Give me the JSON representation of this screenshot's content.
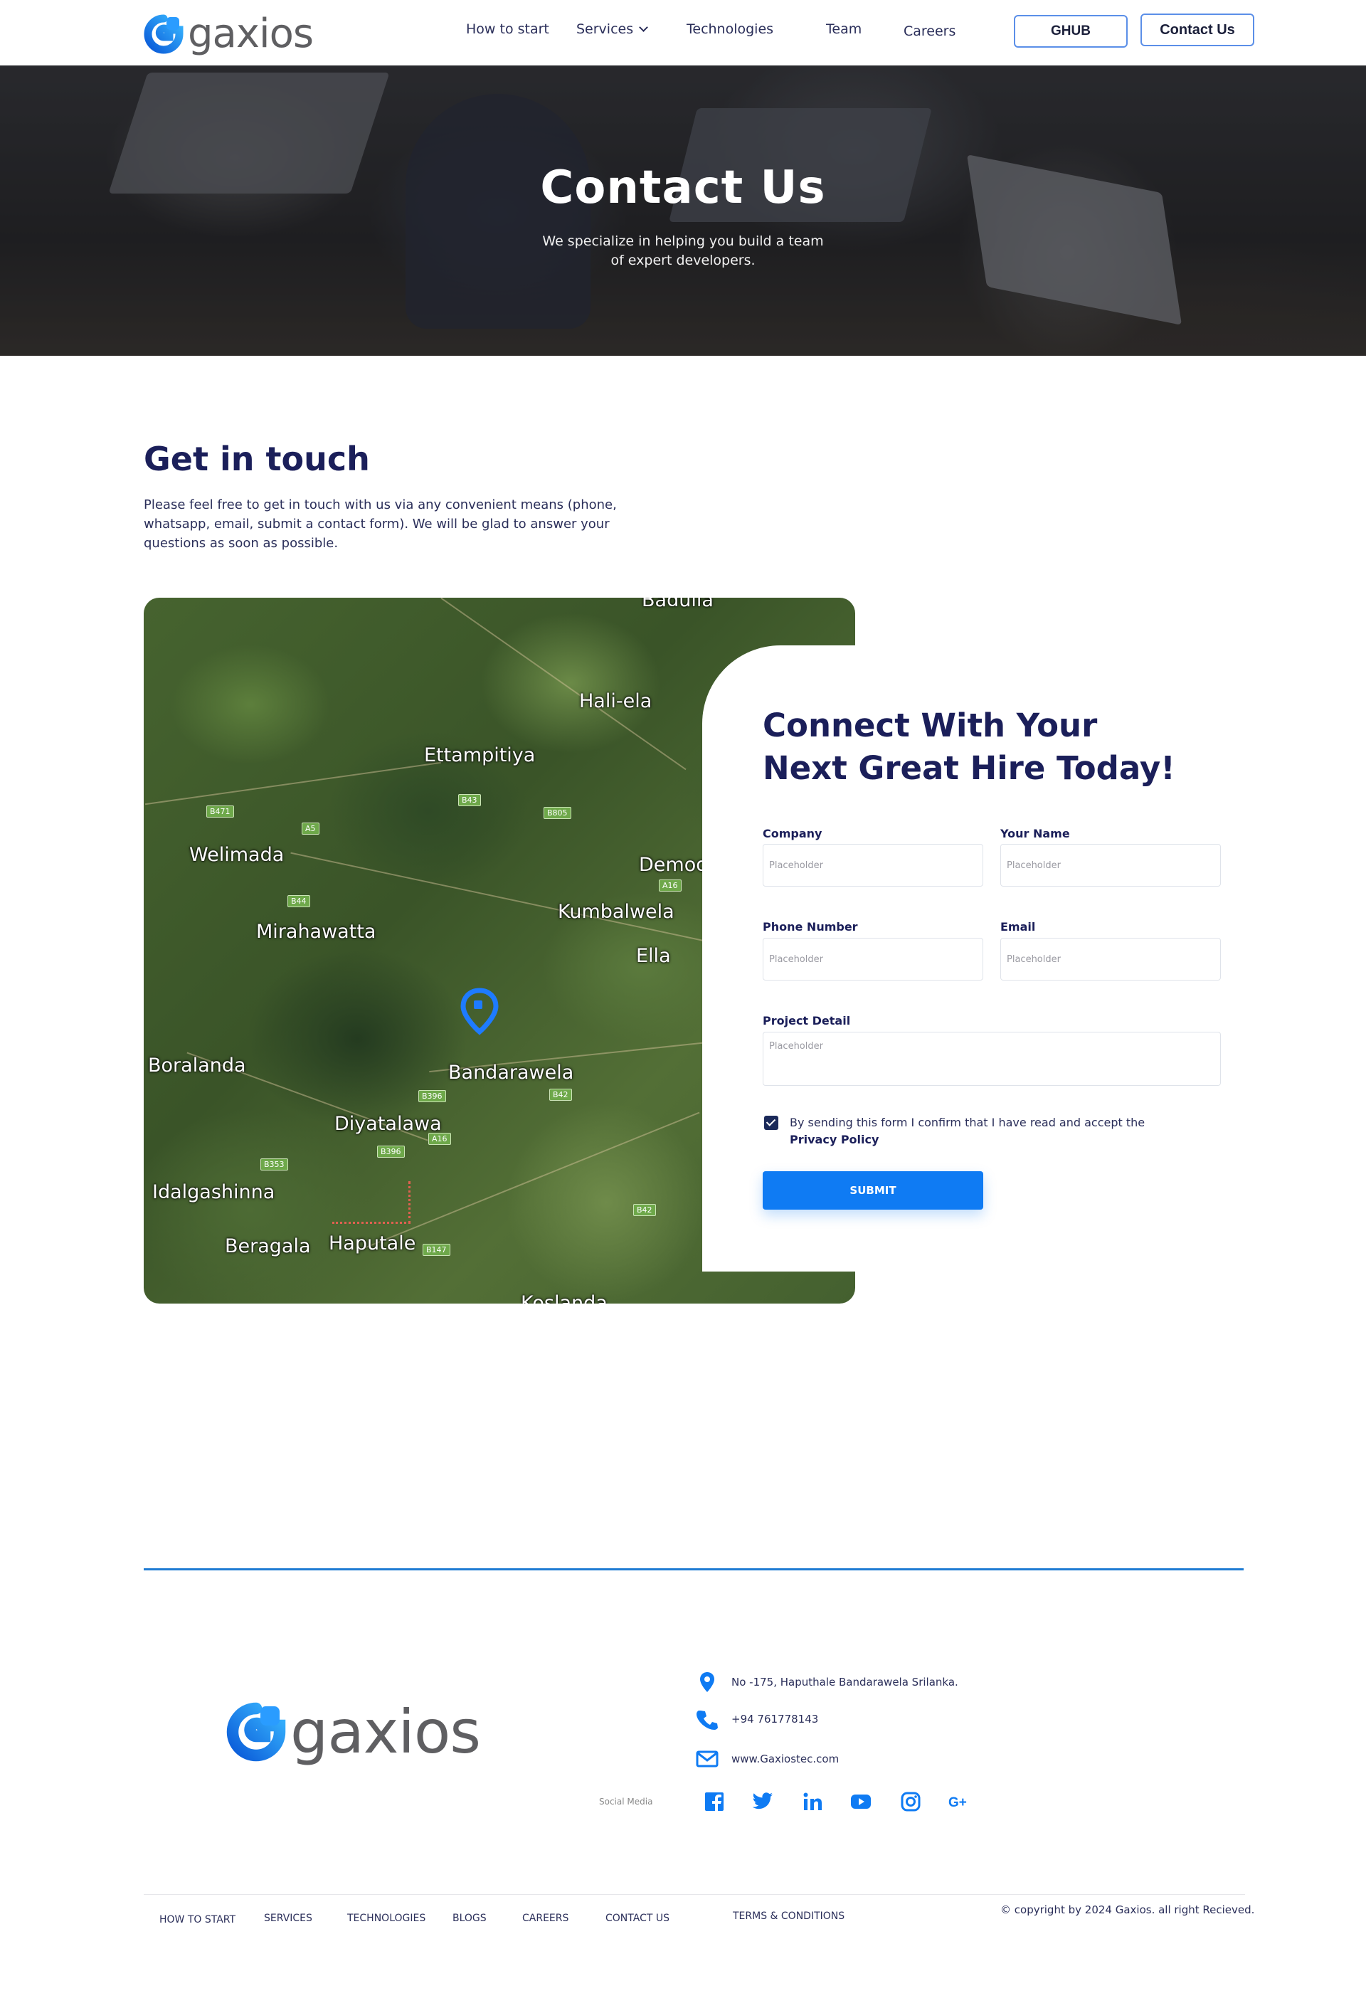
{
  "brand": {
    "name": "gaxios",
    "accent": "#0f7bf3",
    "navy": "#1b1f5a"
  },
  "nav": {
    "items": [
      {
        "label": "How to start"
      },
      {
        "label": "Services"
      },
      {
        "label": "Technologies"
      },
      {
        "label": "Team"
      },
      {
        "label": "Careers"
      }
    ],
    "ghub_label": "GHUB",
    "contact_label": "Contact Us"
  },
  "hero": {
    "title": "Contact Us",
    "subtitle": "We specialize in helping you build a team of expert developers."
  },
  "touch": {
    "title": "Get in touch",
    "text": "Please feel free to get in touch with us via any convenient means (phone, whatsapp, email, submit a contact form). We will be glad to answer your questions as soon as possible."
  },
  "map": {
    "places": [
      "Badulla",
      "Hali-ela",
      "Ettampitiya",
      "Welimada",
      "Demod",
      "Kumbalwela",
      "Mirahawatta",
      "Ella",
      "Boralanda",
      "Bandarawela",
      "Diyatalawa",
      "Idalgashinna",
      "Beragala",
      "Haputale",
      "Koslanda"
    ],
    "road_shields": [
      "B471",
      "A5",
      "B43",
      "B805",
      "B44",
      "A16",
      "B396",
      "B42",
      "A16",
      "B396",
      "B353",
      "B42",
      "B147"
    ]
  },
  "form": {
    "title_line1": "Connect With Your",
    "title_line2": "Next Great Hire Today!",
    "company_label": "Company",
    "name_label": "Your Name",
    "phone_label": "Phone Number",
    "email_label": "Email",
    "project_label": "Project Detail",
    "placeholder": "Placeholder",
    "consent_text": "By sending this form I confirm that I have read and accept the",
    "privacy_label": "Privacy Policy",
    "submit_label": "SUBMIT"
  },
  "footer": {
    "address": "No -175, Haputhale Bandarawela Srilanka.",
    "phone": "+94 761778143",
    "website": "www.Gaxiostec.com",
    "social_label": "Social Media",
    "social_icons": [
      "facebook-icon",
      "twitter-icon",
      "linkedin-icon",
      "youtube-icon",
      "instagram-icon",
      "google-plus-icon"
    ],
    "links": [
      "HOW TO START",
      "SERVICES",
      "TECHNOLOGIES",
      "BLOGS",
      "CAREERS",
      "CONTACT US"
    ],
    "terms_label": "TERMS & CONDITIONS",
    "copyright": "© copyright by 2024 Gaxios. all right Recieved."
  }
}
